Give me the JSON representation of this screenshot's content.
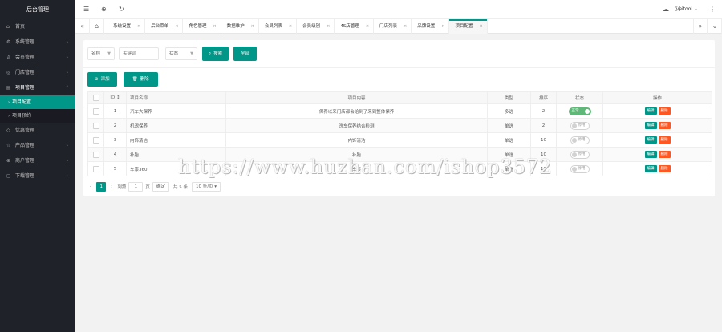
{
  "brand": "后台管理",
  "sidebar": {
    "items": [
      {
        "icon": "home-icon",
        "glyph": "⌂",
        "label": "首页"
      },
      {
        "icon": "gear-icon",
        "glyph": "⚙",
        "label": "系统管理"
      },
      {
        "icon": "user-icon",
        "glyph": "♙",
        "label": "会员管理"
      },
      {
        "icon": "store-icon",
        "glyph": "◎",
        "label": "门店管理"
      },
      {
        "icon": "project-icon",
        "glyph": "▤",
        "label": "项目管理"
      }
    ],
    "sub_items": [
      {
        "label": "项目配置",
        "active": true
      },
      {
        "label": "项目预约",
        "active": false
      }
    ],
    "items_after": [
      {
        "icon": "coupon-icon",
        "glyph": "◇",
        "label": "优惠管理"
      },
      {
        "icon": "product-icon",
        "glyph": "☆",
        "label": "产品管理"
      },
      {
        "icon": "merchant-icon",
        "glyph": "⊕",
        "label": "商户管理"
      },
      {
        "icon": "download-icon",
        "glyph": "▢",
        "label": "下载管理"
      }
    ]
  },
  "header": {
    "user": "veitool"
  },
  "tabs": [
    "系统设置",
    "后台菜单",
    "角色管理",
    "数据维护",
    "会员列表",
    "会员级别",
    "4S店管理",
    "门店列表",
    "品牌设置",
    "项目配置"
  ],
  "active_tab": "项目配置",
  "search": {
    "field_select": "名称",
    "keyword_placeholder": "关键词",
    "status_select": "状态",
    "search_button": "搜索",
    "all_button": "全部"
  },
  "actions": {
    "add": "添加",
    "delete": "删除"
  },
  "table": {
    "headers": [
      "",
      "ID ↕",
      "项目名称",
      "项目内容",
      "类型",
      "排序",
      "状态",
      "操作"
    ],
    "rows": [
      {
        "id": "1",
        "name": "汽车大保养",
        "content": "保养以来门店都会给到了来到整体保养",
        "type": "多选",
        "sort": "2",
        "status": "正常",
        "on": true
      },
      {
        "id": "2",
        "name": "机滤保养",
        "content": "洗车保养结合检测",
        "type": "单选",
        "sort": "2",
        "status": "停用",
        "on": false
      },
      {
        "id": "3",
        "name": "内饰清洁",
        "content": "内饰清洁",
        "type": "单选",
        "sort": "10",
        "status": "停用",
        "on": false
      },
      {
        "id": "4",
        "name": "补胎",
        "content": "补胎",
        "type": "单选",
        "sort": "10",
        "status": "停用",
        "on": false
      },
      {
        "id": "5",
        "name": "车漆360",
        "content": "车漆",
        "type": "单选",
        "sort": "10",
        "status": "停用",
        "on": false
      }
    ],
    "edit_label": "编辑",
    "delete_label": "删除"
  },
  "pager": {
    "current": "1",
    "goto_label": "到第",
    "page_input": "1",
    "page_unit": "页",
    "confirm": "确定",
    "total": "共 5 条",
    "per_page": "10 条/页"
  },
  "watermark": "https://www.huzhan.com/ishop3572"
}
